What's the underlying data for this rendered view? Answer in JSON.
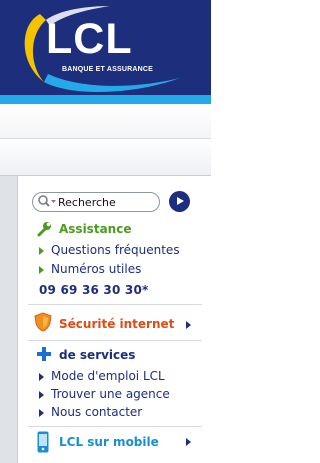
{
  "header": {
    "logo_text": "LCL",
    "logo_subtitle": "BANQUE ET ASSURANCE",
    "colors": {
      "navy": "#1d2e7d",
      "light_blue": "#25a9e8",
      "gold": "#f3c300"
    }
  },
  "search": {
    "value": "Recherche",
    "icon": "search-icon",
    "go_icon": "arrow-right-icon"
  },
  "assistance": {
    "title": "Assistance",
    "icon": "wrench-icon",
    "items": [
      "Questions fréquentes",
      "Numéros utiles"
    ],
    "phone": "09 69 36 30 30*"
  },
  "security": {
    "title": "Sécurité internet",
    "icon": "shield-icon"
  },
  "services": {
    "title": "de services",
    "icon": "plus-icon",
    "items": [
      "Mode d'emploi LCL",
      "Trouver une agence",
      "Nous contacter"
    ]
  },
  "mobile": {
    "title": "LCL sur mobile",
    "icon": "mobile-phone-icon"
  }
}
